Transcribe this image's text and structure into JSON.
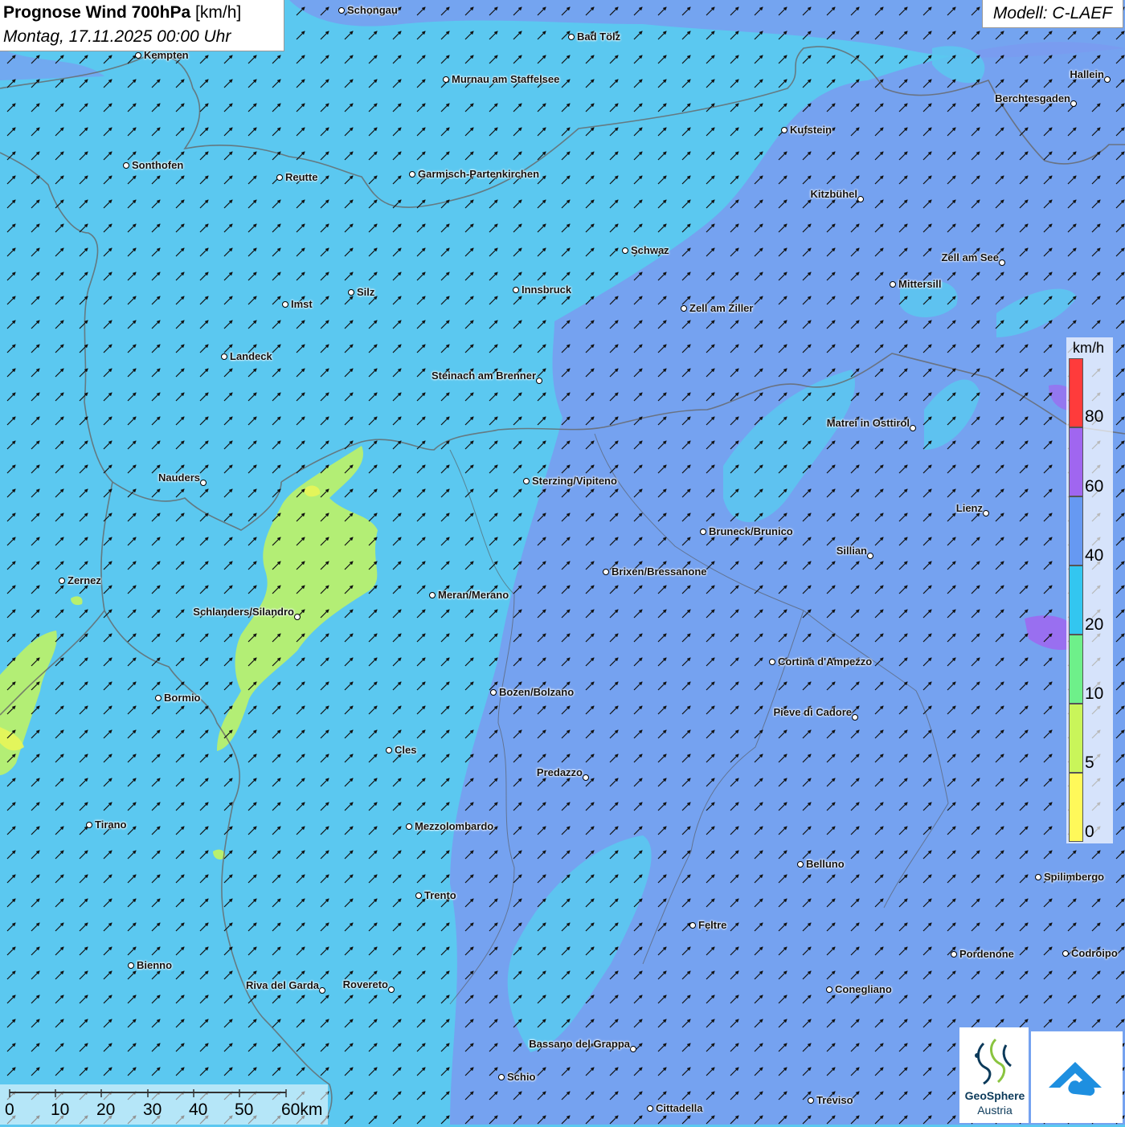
{
  "title": {
    "bold": "Prognose Wind 700hPa",
    "unit": "[km/h]",
    "date": "Montag, 17.11.2025 00:00 Uhr"
  },
  "model": "Modell: C-LAEF",
  "legend": {
    "unit": "km/h",
    "labels": [
      "80",
      "60",
      "40",
      "20",
      "10",
      "5",
      "0"
    ],
    "colors": [
      "#ff3b3b",
      "#a066f0",
      "#6699f2",
      "#33c6f0",
      "#6ef08a",
      "#c9f55a",
      "#fff95a"
    ]
  },
  "scale": {
    "labels": [
      "0",
      "10",
      "20",
      "30",
      "40",
      "50",
      "60km"
    ]
  },
  "logo": {
    "name": "GeoSphere",
    "country": "Austria",
    "icon": "geosphere-logo-icon",
    "icon2": "cloud-arrow-logo-icon"
  },
  "wind": {
    "direction": "southwest",
    "dominant_color": "#5bc8f0"
  },
  "cities": [
    "Schongau",
    "Bad Tölz",
    "Kempten",
    "Murnau am Staffelsee",
    "Hallein",
    "Berchtesgaden",
    "Kufstein",
    "Sonthofen",
    "Reutte",
    "Garmisch-Partenkirchen",
    "Kitzbühel",
    "Schwaz",
    "Zell am See",
    "Mittersill",
    "Innsbruck",
    "Zell am Ziller",
    "Imst",
    "Silz",
    "Landeck",
    "Steinach am Brenner",
    "Matrei in Osttirol",
    "Nauders",
    "Sterzing/Vipiteno",
    "Lienz",
    "Bruneck/Brunico",
    "Sillian",
    "Brixen/Bressanone",
    "Zernez",
    "Meran/Merano",
    "Schlanders/Silandro",
    "Cortina d'Ampezzo",
    "Bormio",
    "Bozen/Bolzano",
    "Pieve di Cadore",
    "Cles",
    "Predazzo",
    "Tirano",
    "Mezzolombardo",
    "Belluno",
    "Spilimbergo",
    "Trento",
    "Feltre",
    "Pordenone",
    "Codroipo",
    "Bienno",
    "Riva del Garda",
    "Rovereto",
    "Conegliano",
    "Bassano del Grappa",
    "Schio",
    "Treviso",
    "Cittadella"
  ]
}
